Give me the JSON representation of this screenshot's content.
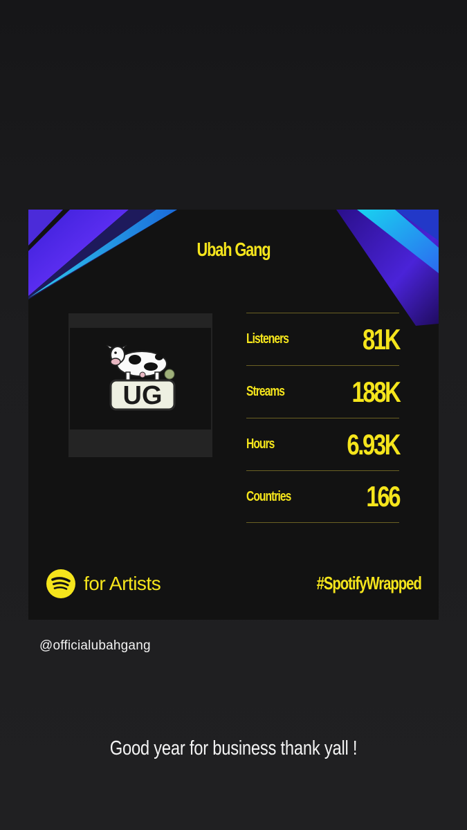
{
  "card": {
    "title": "Ubah Gang",
    "stats": [
      {
        "label": "Listeners",
        "value": "81K"
      },
      {
        "label": "Streams",
        "value": "188K"
      },
      {
        "label": "Hours",
        "value": "6.93K"
      },
      {
        "label": "Countries",
        "value": "166"
      }
    ],
    "brand_text": "for Artists",
    "hashtag": "#SpotifyWrapped",
    "logo_text": "UG",
    "accent_color": "#f5e51c"
  },
  "story": {
    "mention": "@officialubahgang",
    "caption": "Good year for business thank yall !"
  }
}
